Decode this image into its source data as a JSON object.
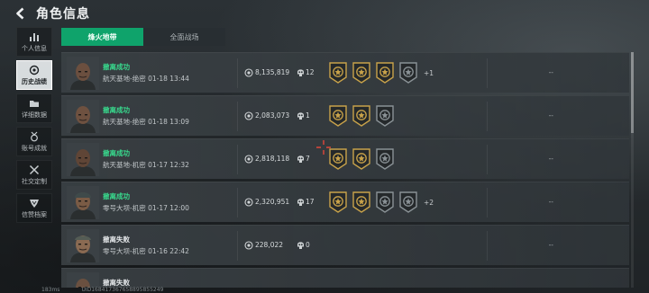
{
  "header": {
    "title": "角色信息",
    "back_icon": "back-arrow-icon"
  },
  "sidebar": {
    "items": [
      {
        "label": "个人信息",
        "icon": "bar-chart-icon",
        "active": false
      },
      {
        "label": "历史战绩",
        "icon": "eye-target-icon",
        "active": true
      },
      {
        "label": "详细数据",
        "icon": "folder-icon",
        "active": false
      },
      {
        "label": "账号成就",
        "icon": "medal-icon",
        "active": false
      },
      {
        "label": "社交定制",
        "icon": "crossed-tools-icon",
        "active": false
      },
      {
        "label": "信赞档案",
        "icon": "shield-icon",
        "active": false
      }
    ]
  },
  "tabs": [
    {
      "label": "烽火地带",
      "active": true
    },
    {
      "label": "全面战场",
      "active": false
    }
  ],
  "matches": [
    {
      "status": "撤离成功",
      "result": "win",
      "map": "航天基地-绝密",
      "time": "01-18 13:44",
      "coins": "8,135,819",
      "kills": "12",
      "badges": [
        "gold",
        "gold",
        "gold",
        "grey"
      ],
      "more": "+1",
      "extra": "--"
    },
    {
      "status": "撤离成功",
      "result": "win",
      "map": "航天基地-绝密",
      "time": "01-18 13:09",
      "coins": "2,083,073",
      "kills": "1",
      "badges": [
        "gold",
        "gold",
        "grey"
      ],
      "more": "",
      "extra": "--"
    },
    {
      "status": "撤离成功",
      "result": "win",
      "map": "航天基地-机密",
      "time": "01-17 12:32",
      "coins": "2,818,118",
      "kills": "7",
      "badges": [
        "gold",
        "gold",
        "grey"
      ],
      "more": "",
      "extra": "--"
    },
    {
      "status": "撤离成功",
      "result": "win",
      "map": "零号大坝-机密",
      "time": "01-17 12:00",
      "coins": "2,320,951",
      "kills": "17",
      "badges": [
        "gold",
        "gold",
        "grey",
        "grey"
      ],
      "more": "+2",
      "extra": "--"
    },
    {
      "status": "撤离失败",
      "result": "lose",
      "map": "零号大坝-机密",
      "time": "01-16 22:42",
      "coins": "228,022",
      "kills": "0",
      "badges": [],
      "more": "",
      "extra": "--"
    },
    {
      "status": "撤离失败",
      "result": "lose",
      "map": "",
      "time": "",
      "coins": "",
      "kills": "",
      "badges": [],
      "more": "",
      "extra": ""
    }
  ],
  "footer": {
    "ping": "183ms",
    "uid": "UID168417367658895855249"
  },
  "colors": {
    "accent": "#0fa36b",
    "win": "#38d98d",
    "badge_gold": "#c8a24a",
    "badge_grey": "#8a9296"
  }
}
